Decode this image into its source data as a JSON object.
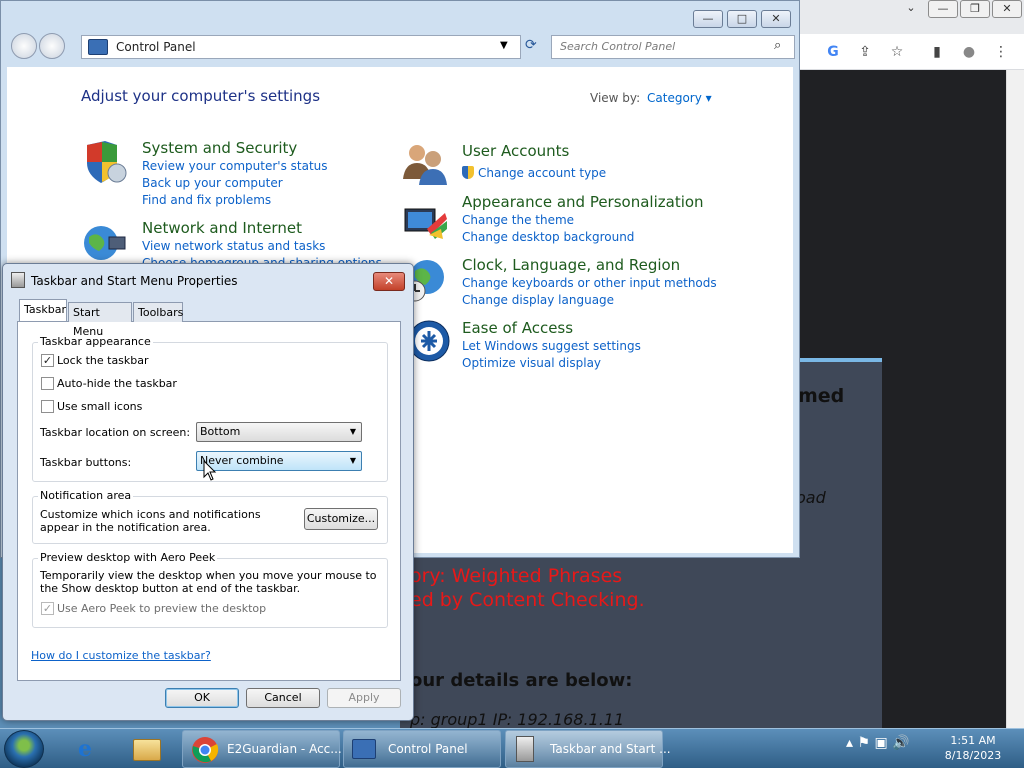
{
  "chrome": {
    "min": "—",
    "restore": "❐",
    "close": "✕",
    "collapse": "⌄",
    "toolbar_icons": [
      "google-icon",
      "share-icon",
      "star-icon",
      "sidepanel-icon",
      "profile-icon",
      "menu-icon"
    ],
    "toolbar_glyphs": [
      "G",
      "⇪",
      "☆",
      "▮",
      "●",
      "⋮"
    ]
  },
  "blocked_page": {
    "heading_fragment": "med",
    "italic_fragment": "oad",
    "red_line1": "ory:  Weighted Phrases",
    "red_line2": "ed by Content Checking.",
    "details_fragment": "our details are below:",
    "group_fragment": "p: group1    IP: 192.168.1.11"
  },
  "control_panel": {
    "address": "Control Panel",
    "search_placeholder": "Search Control Panel",
    "heading": "Adjust your computer's settings",
    "view_by_label": "View by:",
    "view_by_value": "Category",
    "categories": {
      "system_security": {
        "title": "System and Security",
        "links": [
          "Review your computer's status",
          "Back up your computer",
          "Find and fix problems"
        ]
      },
      "network_internet": {
        "title": "Network and Internet",
        "links": [
          "View network status and tasks",
          "Choose homegroup and sharing options"
        ]
      },
      "user_accounts": {
        "title": "User Accounts",
        "links": [
          "Change account type"
        ]
      },
      "appearance": {
        "title": "Appearance and Personalization",
        "links": [
          "Change the theme",
          "Change desktop background"
        ]
      },
      "clock_region": {
        "title": "Clock, Language, and Region",
        "links": [
          "Change keyboards or other input methods",
          "Change display language"
        ]
      },
      "ease_access": {
        "title": "Ease of Access",
        "links": [
          "Let Windows suggest settings",
          "Optimize visual display"
        ]
      }
    }
  },
  "dialog": {
    "title": "Taskbar and Start Menu Properties",
    "close": "✕",
    "tabs": [
      "Taskbar",
      "Start Menu",
      "Toolbars"
    ],
    "appearance_group": "Taskbar appearance",
    "lock_label": "Lock the taskbar",
    "lock_checked": "✓",
    "autohide_label": "Auto-hide the taskbar",
    "small_icons_label": "Use small icons",
    "location_label": "Taskbar location on screen:",
    "location_value": "Bottom",
    "buttons_label": "Taskbar buttons:",
    "buttons_value": "Never combine",
    "notification_group": "Notification area",
    "notification_text": "Customize which icons and notifications appear in the notification area.",
    "customize_button": "Customize...",
    "preview_group": "Preview desktop with Aero Peek",
    "preview_text": "Temporarily view the desktop when you move your mouse to the Show desktop button at end of the taskbar.",
    "aero_label": "Use Aero Peek to preview the desktop",
    "aero_checked": "✓",
    "help_link": "How do I customize the taskbar?",
    "ok": "OK",
    "cancel": "Cancel",
    "apply": "Apply"
  },
  "taskbar": {
    "tasks": [
      "E2Guardian - Acc...",
      "Control Panel",
      "Taskbar and Start ..."
    ],
    "time": "1:51 AM",
    "date": "8/18/2023",
    "tray_glyphs": "▴  ⚑  ▣  🔊"
  }
}
